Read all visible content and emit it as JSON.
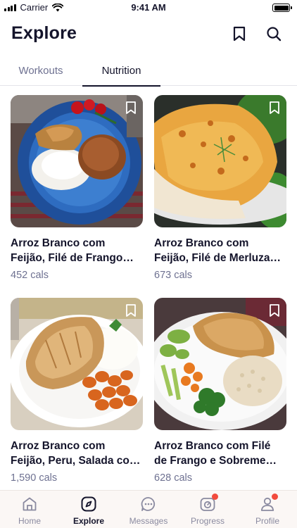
{
  "status_bar": {
    "carrier": "Carrier",
    "time": "9:41 AM"
  },
  "header": {
    "title": "Explore"
  },
  "tabs": [
    {
      "label": "Workouts",
      "active": false
    },
    {
      "label": "Nutrition",
      "active": true
    }
  ],
  "cards": [
    {
      "line1": "Arroz Branco com",
      "line2": "Feijão, Filé de Frango…",
      "cals": "452 cals"
    },
    {
      "line1": "Arroz Branco com",
      "line2": "Feijão, Filé de Merluza…",
      "cals": "673 cals"
    },
    {
      "line1": "Arroz Branco com",
      "line2": "Feijão, Peru, Salada co…",
      "cals": "1,590 cals"
    },
    {
      "line1": "Arroz Branco com Filé",
      "line2": "de Frango e Sobreme…",
      "cals": "628 cals"
    }
  ],
  "tabbar": [
    {
      "label": "Home",
      "icon": "home-icon",
      "active": false
    },
    {
      "label": "Explore",
      "icon": "compass-icon",
      "active": true
    },
    {
      "label": "Messages",
      "icon": "chat-icon",
      "active": false
    },
    {
      "label": "Progress",
      "icon": "progress-icon",
      "active": false,
      "badge": true
    },
    {
      "label": "Profile",
      "icon": "profile-icon",
      "active": false,
      "badge": true
    }
  ],
  "colors": {
    "accent": "#14142b",
    "muted": "#6e7191",
    "badge": "#f24b3d",
    "tabbar_bg": "#fbf7f5"
  }
}
